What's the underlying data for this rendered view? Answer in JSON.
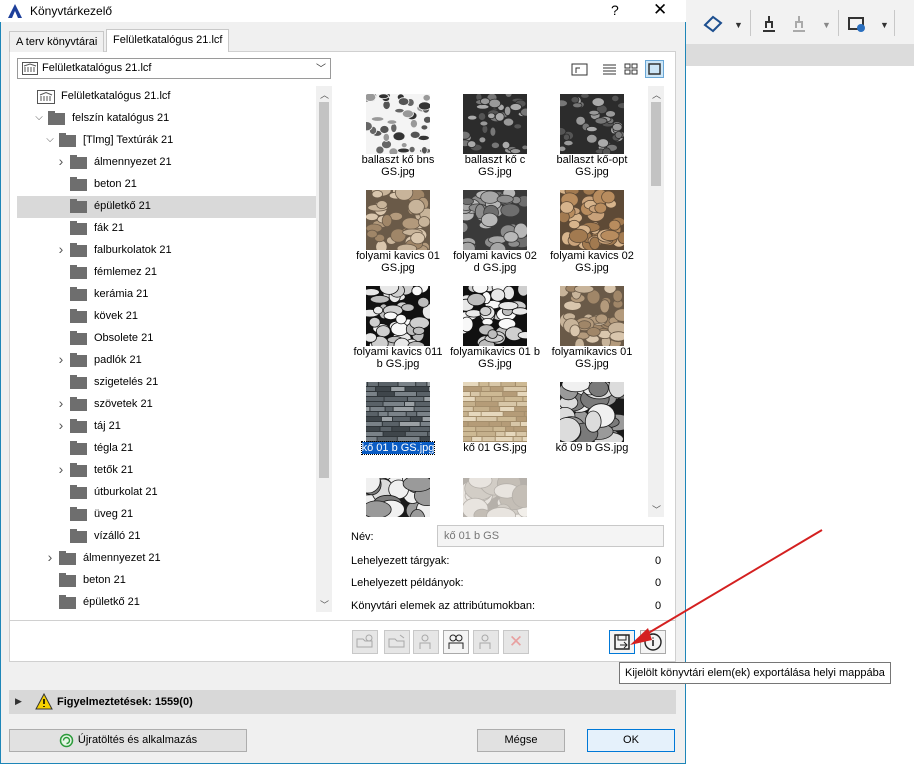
{
  "window": {
    "title": "Könyvtárkezelő",
    "help_glyph": "?",
    "close_glyph": "✕"
  },
  "tabs": [
    {
      "label": "A terv könyvtárai"
    },
    {
      "label": "Felületkatalógus 21.lcf"
    }
  ],
  "combo": {
    "value": "Felületkatalógus 21.lcf"
  },
  "tree": [
    {
      "label": "Felületkatalógus 21.lcf",
      "level": 0,
      "chevron": "",
      "icon": "library"
    },
    {
      "label": "felszín katalógus 21",
      "level": 1,
      "chevron": "open"
    },
    {
      "label": "[Tlmg] Textúrák 21",
      "level": 2,
      "chevron": "open"
    },
    {
      "label": "álmennyezet 21",
      "level": 3,
      "chevron": "closed"
    },
    {
      "label": "beton 21",
      "level": 3,
      "chevron": ""
    },
    {
      "label": "épületkő 21",
      "level": 3,
      "chevron": "",
      "selected": true
    },
    {
      "label": "fák 21",
      "level": 3,
      "chevron": ""
    },
    {
      "label": "falburkolatok 21",
      "level": 3,
      "chevron": "closed"
    },
    {
      "label": "fémlemez 21",
      "level": 3,
      "chevron": ""
    },
    {
      "label": "kerámia 21",
      "level": 3,
      "chevron": ""
    },
    {
      "label": "kövek 21",
      "level": 3,
      "chevron": ""
    },
    {
      "label": "Obsolete 21",
      "level": 3,
      "chevron": ""
    },
    {
      "label": "padlók 21",
      "level": 3,
      "chevron": "closed"
    },
    {
      "label": "szigetelés 21",
      "level": 3,
      "chevron": ""
    },
    {
      "label": "szövetek 21",
      "level": 3,
      "chevron": "closed"
    },
    {
      "label": "táj 21",
      "level": 3,
      "chevron": "closed"
    },
    {
      "label": "tégla 21",
      "level": 3,
      "chevron": ""
    },
    {
      "label": "tetők 21",
      "level": 3,
      "chevron": "closed"
    },
    {
      "label": "útburkolat 21",
      "level": 3,
      "chevron": ""
    },
    {
      "label": "üveg 21",
      "level": 3,
      "chevron": ""
    },
    {
      "label": "vízálló 21",
      "level": 3,
      "chevron": ""
    },
    {
      "label": "álmennyezet 21",
      "level": 2,
      "chevron": "closed"
    },
    {
      "label": "beton 21",
      "level": 2,
      "chevron": ""
    },
    {
      "label": "épületkő 21",
      "level": 2,
      "chevron": ""
    }
  ],
  "grid": [
    {
      "label": "ballaszt kő bns GS.jpg",
      "tex": "gravel-gray"
    },
    {
      "label": "ballaszt kő c GS.jpg",
      "tex": "gravel-dark"
    },
    {
      "label": "ballaszt kő-opt GS.jpg",
      "tex": "gravel-dark"
    },
    {
      "label": "folyami kavics 01 GS.jpg",
      "tex": "stone-tan"
    },
    {
      "label": "folyami kavics 02 d GS.jpg",
      "tex": "stone-gray"
    },
    {
      "label": "folyami kavics 02 GS.jpg",
      "tex": "stone-tan2"
    },
    {
      "label": "folyami kavics 011 b GS.jpg",
      "tex": "pebble-bw"
    },
    {
      "label": "folyamikavics 01 b GS.jpg",
      "tex": "pebble-bw"
    },
    {
      "label": "folyamikavics 01 GS.jpg",
      "tex": "stone-tan"
    },
    {
      "label": "kő 01 b GS.jpg",
      "tex": "slate-gray",
      "selected": true
    },
    {
      "label": "kő 01 GS.jpg",
      "tex": "slate-tan"
    },
    {
      "label": "kő 09 b GS.jpg",
      "tex": "boulder-bw"
    },
    {
      "label": "",
      "tex": "boulder-bw"
    },
    {
      "label": "",
      "tex": "rock-light"
    },
    {
      "label": "",
      "tex": "dark-strip"
    }
  ],
  "details": {
    "name_label": "Név:",
    "name_value": "kő 01 b GS",
    "placed_objects_label": "Lehelyezett tárgyak:",
    "placed_objects_value": "0",
    "placed_instances_label": "Lehelyezett példányok:",
    "placed_instances_value": "0",
    "attribute_items_label": "Könyvtári elemek az attribútumokban:",
    "attribute_items_value": "0"
  },
  "tooltip": "Kijelölt könyvtári elem(ek) exportálása helyi mappába",
  "warnings": {
    "label": "Figyelmeztetések: 1559(0)"
  },
  "buttons": {
    "reload": "Újratöltés és alkalmazás",
    "cancel": "Mégse",
    "ok": "OK"
  },
  "colors": {
    "accent": "#0078d7",
    "selection": "#0a5cc4",
    "arrow": "#d42020"
  }
}
